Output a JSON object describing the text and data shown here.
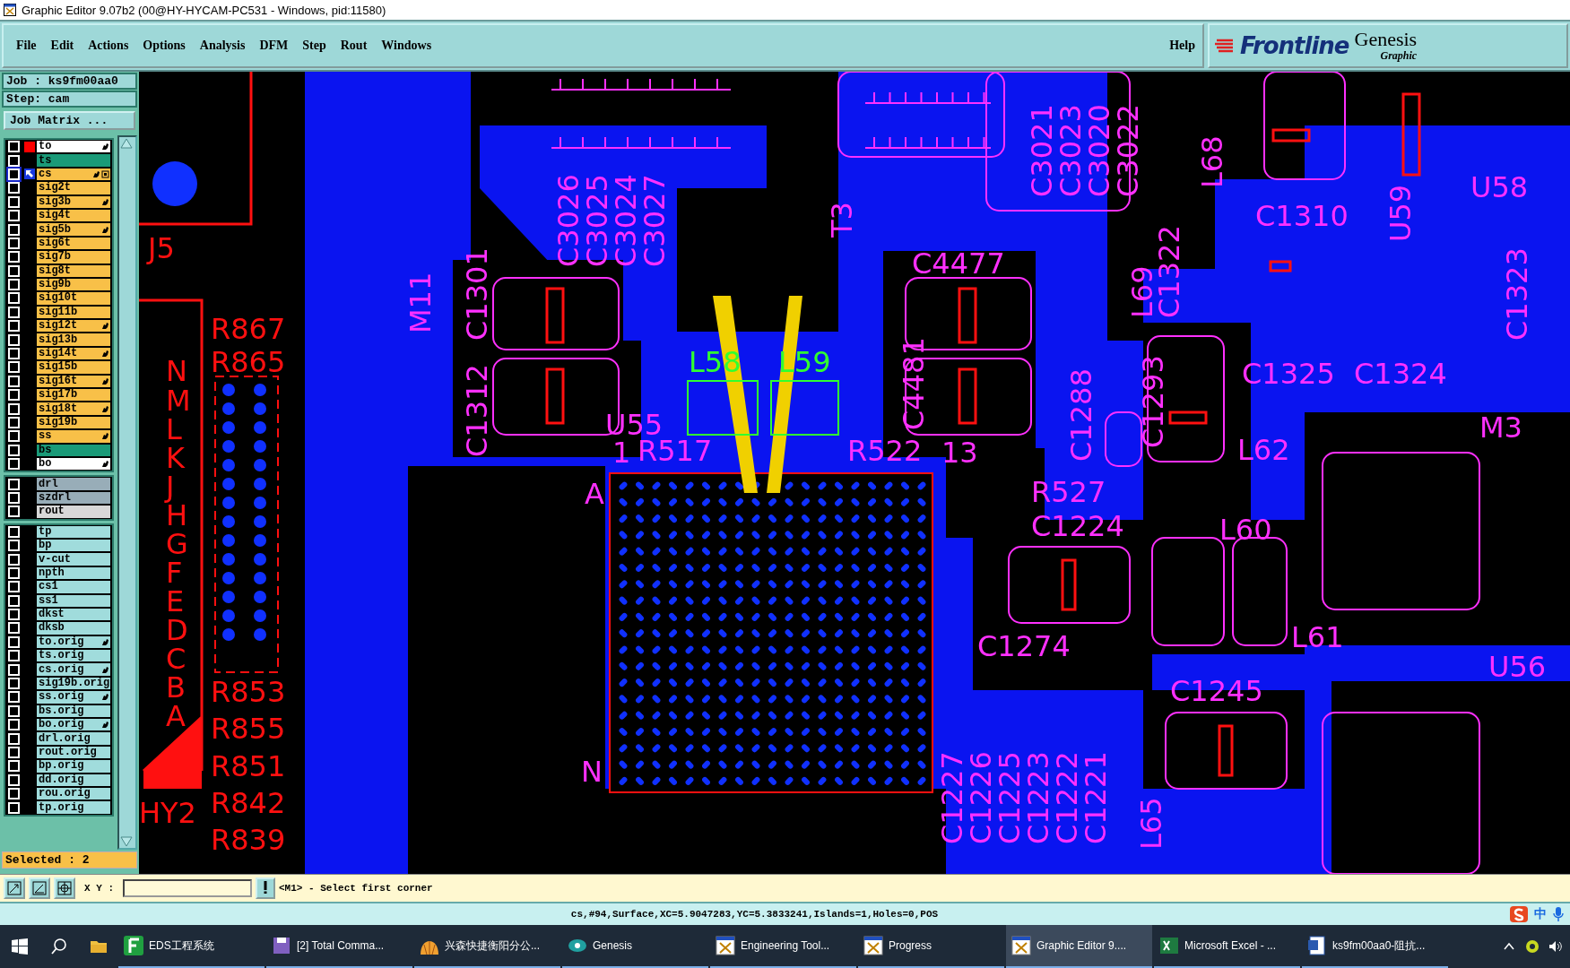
{
  "window": {
    "title": "Graphic Editor 9.07b2 (00@HY-HYCAM-PC531 - Windows, pid:11580)"
  },
  "menu": [
    "File",
    "Edit",
    "Actions",
    "Options",
    "Analysis",
    "DFM",
    "Step",
    "Rout",
    "Windows"
  ],
  "help_menu": "Help",
  "logo": {
    "brand": "Frontline",
    "product": "Genesis",
    "subtitle": "Graphic"
  },
  "panel": {
    "job": "Job : ks9fm00aa0",
    "step": "Step: cam",
    "job_matrix_button": "Job Matrix ...",
    "selected": "Selected : 2",
    "layer_groups": [
      {
        "layers": [
          {
            "name": "to",
            "color": "#ffffff",
            "shown": true,
            "work": false,
            "affected": true,
            "grid_mark": false
          },
          {
            "name": "ts",
            "color": "#1a9a78",
            "shown": false,
            "work": false,
            "affected": false,
            "grid_mark": false
          },
          {
            "name": "cs",
            "color": "#f8c048",
            "shown": false,
            "work": true,
            "affected": true,
            "grid_mark": true
          },
          {
            "name": "sig2t",
            "color": "#f8c048",
            "shown": false,
            "work": false,
            "affected": false,
            "grid_mark": false
          },
          {
            "name": "sig3b",
            "color": "#f8c048",
            "shown": false,
            "work": false,
            "affected": true,
            "grid_mark": false
          },
          {
            "name": "sig4t",
            "color": "#f8c048",
            "shown": false,
            "work": false,
            "affected": false,
            "grid_mark": false
          },
          {
            "name": "sig5b",
            "color": "#f8c048",
            "shown": false,
            "work": false,
            "affected": true,
            "grid_mark": false
          },
          {
            "name": "sig6t",
            "color": "#f8c048",
            "shown": false,
            "work": false,
            "affected": false,
            "grid_mark": false
          },
          {
            "name": "sig7b",
            "color": "#f8c048",
            "shown": false,
            "work": false,
            "affected": false,
            "grid_mark": false
          },
          {
            "name": "sig8t",
            "color": "#f8c048",
            "shown": false,
            "work": false,
            "affected": false,
            "grid_mark": false
          },
          {
            "name": "sig9b",
            "color": "#f8c048",
            "shown": false,
            "work": false,
            "affected": false,
            "grid_mark": false
          },
          {
            "name": "sig10t",
            "color": "#f8c048",
            "shown": false,
            "work": false,
            "affected": false,
            "grid_mark": false
          },
          {
            "name": "sig11b",
            "color": "#f8c048",
            "shown": false,
            "work": false,
            "affected": false,
            "grid_mark": false
          },
          {
            "name": "sig12t",
            "color": "#f8c048",
            "shown": false,
            "work": false,
            "affected": true,
            "grid_mark": false
          },
          {
            "name": "sig13b",
            "color": "#f8c048",
            "shown": false,
            "work": false,
            "affected": false,
            "grid_mark": false
          },
          {
            "name": "sig14t",
            "color": "#f8c048",
            "shown": false,
            "work": false,
            "affected": true,
            "grid_mark": false
          },
          {
            "name": "sig15b",
            "color": "#f8c048",
            "shown": false,
            "work": false,
            "affected": false,
            "grid_mark": false
          },
          {
            "name": "sig16t",
            "color": "#f8c048",
            "shown": false,
            "work": false,
            "affected": true,
            "grid_mark": false
          },
          {
            "name": "sig17b",
            "color": "#f8c048",
            "shown": false,
            "work": false,
            "affected": false,
            "grid_mark": false
          },
          {
            "name": "sig18t",
            "color": "#f8c048",
            "shown": false,
            "work": false,
            "affected": true,
            "grid_mark": false
          },
          {
            "name": "sig19b",
            "color": "#f8c048",
            "shown": false,
            "work": false,
            "affected": false,
            "grid_mark": false
          },
          {
            "name": "ss",
            "color": "#f8c048",
            "shown": false,
            "work": false,
            "affected": true,
            "grid_mark": false
          },
          {
            "name": "bs",
            "color": "#1a9a78",
            "shown": false,
            "work": false,
            "affected": false,
            "grid_mark": false
          },
          {
            "name": "bo",
            "color": "#ffffff",
            "shown": false,
            "work": false,
            "affected": true,
            "grid_mark": false
          }
        ]
      },
      {
        "layers": [
          {
            "name": "drl",
            "color": "#98adb8",
            "shown": false,
            "work": false,
            "affected": false,
            "grid_mark": false
          },
          {
            "name": "szdrl",
            "color": "#98adb8",
            "shown": false,
            "work": false,
            "affected": false,
            "grid_mark": false
          },
          {
            "name": "rout",
            "color": "#d8d8d8",
            "shown": false,
            "work": false,
            "affected": false,
            "grid_mark": false
          }
        ]
      },
      {
        "layers": [
          {
            "name": "tp",
            "color": "#a0dcdc",
            "shown": false,
            "work": false,
            "affected": false,
            "grid_mark": false
          },
          {
            "name": "bp",
            "color": "#a0dcdc",
            "shown": false,
            "work": false,
            "affected": false,
            "grid_mark": false
          },
          {
            "name": "v-cut",
            "color": "#a0dcdc",
            "shown": false,
            "work": false,
            "affected": false,
            "grid_mark": false
          },
          {
            "name": "npth",
            "color": "#a0dcdc",
            "shown": false,
            "work": false,
            "affected": false,
            "grid_mark": false
          },
          {
            "name": "cs1",
            "color": "#a0dcdc",
            "shown": false,
            "work": false,
            "affected": false,
            "grid_mark": false
          },
          {
            "name": "ss1",
            "color": "#a0dcdc",
            "shown": false,
            "work": false,
            "affected": false,
            "grid_mark": false
          },
          {
            "name": "dkst",
            "color": "#a0dcdc",
            "shown": false,
            "work": false,
            "affected": false,
            "grid_mark": false
          },
          {
            "name": "dksb",
            "color": "#a0dcdc",
            "shown": false,
            "work": false,
            "affected": false,
            "grid_mark": false
          },
          {
            "name": "to.orig",
            "color": "#a0dcdc",
            "shown": false,
            "work": false,
            "affected": true,
            "grid_mark": false
          },
          {
            "name": "ts.orig",
            "color": "#a0dcdc",
            "shown": false,
            "work": false,
            "affected": false,
            "grid_mark": false
          },
          {
            "name": "cs.orig",
            "color": "#a0dcdc",
            "shown": false,
            "work": false,
            "affected": true,
            "grid_mark": false
          },
          {
            "name": "sig19b.orig",
            "color": "#a0dcdc",
            "shown": false,
            "work": false,
            "affected": false,
            "grid_mark": false
          },
          {
            "name": "ss.orig",
            "color": "#a0dcdc",
            "shown": false,
            "work": false,
            "affected": true,
            "grid_mark": false
          },
          {
            "name": "bs.orig",
            "color": "#a0dcdc",
            "shown": false,
            "work": false,
            "affected": false,
            "grid_mark": false
          },
          {
            "name": "bo.orig",
            "color": "#a0dcdc",
            "shown": false,
            "work": false,
            "affected": true,
            "grid_mark": false
          },
          {
            "name": "drl.orig",
            "color": "#a0dcdc",
            "shown": false,
            "work": false,
            "affected": false,
            "grid_mark": false
          },
          {
            "name": "rout.orig",
            "color": "#a0dcdc",
            "shown": false,
            "work": false,
            "affected": false,
            "grid_mark": false
          },
          {
            "name": "bp.orig",
            "color": "#a0dcdc",
            "shown": false,
            "work": false,
            "affected": false,
            "grid_mark": false
          },
          {
            "name": "dd.orig",
            "color": "#a0dcdc",
            "shown": false,
            "work": false,
            "affected": false,
            "grid_mark": false
          },
          {
            "name": "rou.orig",
            "color": "#a0dcdc",
            "shown": false,
            "work": false,
            "affected": false,
            "grid_mark": false
          },
          {
            "name": "tp.orig",
            "color": "#a0dcdc",
            "shown": false,
            "work": false,
            "affected": false,
            "grid_mark": false
          }
        ]
      }
    ]
  },
  "canvas": {
    "labels": [
      {
        "text": "J5",
        "color": "#ff1010"
      },
      {
        "text": "R867",
        "color": "#ff1010"
      },
      {
        "text": "R865",
        "color": "#ff1010"
      },
      {
        "text": "N",
        "color": "#ff1010"
      },
      {
        "text": "M",
        "color": "#ff1010"
      },
      {
        "text": "L",
        "color": "#ff1010"
      },
      {
        "text": "K",
        "color": "#ff1010"
      },
      {
        "text": "J",
        "color": "#ff1010"
      },
      {
        "text": "H",
        "color": "#ff1010"
      },
      {
        "text": "G",
        "color": "#ff1010"
      },
      {
        "text": "F",
        "color": "#ff1010"
      },
      {
        "text": "E",
        "color": "#ff1010"
      },
      {
        "text": "D",
        "color": "#ff1010"
      },
      {
        "text": "C",
        "color": "#ff1010"
      },
      {
        "text": "B",
        "color": "#ff1010"
      },
      {
        "text": "A",
        "color": "#ff1010"
      },
      {
        "text": "R853",
        "color": "#ff1010"
      },
      {
        "text": "R855",
        "color": "#ff1010"
      },
      {
        "text": "R851",
        "color": "#ff1010"
      },
      {
        "text": "R842",
        "color": "#ff1010"
      },
      {
        "text": "R839",
        "color": "#ff1010"
      },
      {
        "text": "HY2",
        "color": "#ff1010"
      },
      {
        "text": "C3026",
        "color": "#ff30ff"
      },
      {
        "text": "C3025",
        "color": "#ff30ff"
      },
      {
        "text": "C3024",
        "color": "#ff30ff"
      },
      {
        "text": "C3027",
        "color": "#ff30ff"
      },
      {
        "text": "C3021",
        "color": "#ff30ff"
      },
      {
        "text": "C3023",
        "color": "#ff30ff"
      },
      {
        "text": "C3020",
        "color": "#ff30ff"
      },
      {
        "text": "C3022",
        "color": "#ff30ff"
      },
      {
        "text": "T3",
        "color": "#ff30ff"
      },
      {
        "text": "M11",
        "color": "#ff30ff"
      },
      {
        "text": "C1301",
        "color": "#ff30ff"
      },
      {
        "text": "C1312",
        "color": "#ff30ff"
      },
      {
        "text": "L58",
        "color": "#30ff30"
      },
      {
        "text": "L59",
        "color": "#30ff30"
      },
      {
        "text": "U55",
        "color": "#ff30ff"
      },
      {
        "text": "1",
        "color": "#ff30ff"
      },
      {
        "text": "R517",
        "color": "#ff30ff"
      },
      {
        "text": "R522",
        "color": "#ff30ff"
      },
      {
        "text": "C4477",
        "color": "#ff30ff"
      },
      {
        "text": "C4481",
        "color": "#ff30ff"
      },
      {
        "text": "13",
        "color": "#ff30ff"
      },
      {
        "text": "C1288",
        "color": "#ff30ff"
      },
      {
        "text": "C1293",
        "color": "#ff30ff"
      },
      {
        "text": "L69",
        "color": "#ff30ff"
      },
      {
        "text": "C1322",
        "color": "#ff30ff"
      },
      {
        "text": "L68",
        "color": "#ff30ff"
      },
      {
        "text": "C1310",
        "color": "#ff30ff"
      },
      {
        "text": "U59",
        "color": "#ff30ff"
      },
      {
        "text": "U58",
        "color": "#ff30ff"
      },
      {
        "text": "C1323",
        "color": "#ff30ff"
      },
      {
        "text": "C1325",
        "color": "#ff30ff"
      },
      {
        "text": "C1324",
        "color": "#ff30ff"
      },
      {
        "text": "M3",
        "color": "#ff30ff"
      },
      {
        "text": "L62",
        "color": "#ff30ff"
      },
      {
        "text": "R527",
        "color": "#ff30ff"
      },
      {
        "text": "C1224",
        "color": "#ff30ff"
      },
      {
        "text": "L60",
        "color": "#ff30ff"
      },
      {
        "text": "C1274",
        "color": "#ff30ff"
      },
      {
        "text": "L61",
        "color": "#ff30ff"
      },
      {
        "text": "U56",
        "color": "#ff30ff"
      },
      {
        "text": "C1245",
        "color": "#ff30ff"
      },
      {
        "text": "C1227",
        "color": "#ff30ff"
      },
      {
        "text": "C1226",
        "color": "#ff30ff"
      },
      {
        "text": "C1225",
        "color": "#ff30ff"
      },
      {
        "text": "C1223",
        "color": "#ff30ff"
      },
      {
        "text": "C1222",
        "color": "#ff30ff"
      },
      {
        "text": "C1221",
        "color": "#ff30ff"
      },
      {
        "text": "L65",
        "color": "#ff30ff"
      },
      {
        "text": "A",
        "color": "#ff30ff"
      },
      {
        "text": "N",
        "color": "#ff30ff"
      }
    ]
  },
  "command_bar": {
    "coordinate_label": "X Y :",
    "prompt": "<M1> - Select first corner"
  },
  "status_bar": "cs,#94,Surface,XC=5.9047283,YC=5.3833241,Islands=1,Holes=0,POS",
  "taskbar": {
    "apps": [
      {
        "label": "EDS工程系统",
        "kind": "eds",
        "selected": false
      },
      {
        "label": "[2] Total Comma...",
        "kind": "disk",
        "selected": false
      },
      {
        "label": "兴森快捷衡阳分公...",
        "kind": "shell",
        "selected": false
      },
      {
        "label": "Genesis",
        "kind": "genesis",
        "selected": false
      },
      {
        "label": "Engineering Tool...",
        "kind": "editor",
        "selected": false
      },
      {
        "label": "Progress",
        "kind": "editor",
        "selected": false
      },
      {
        "label": "Graphic Editor 9....",
        "kind": "editor",
        "selected": true
      },
      {
        "label": "Microsoft Excel - ...",
        "kind": "excel",
        "selected": false
      },
      {
        "label": "ks9fm00aa0-阻抗...",
        "kind": "document",
        "selected": false
      }
    ],
    "ime": "中"
  }
}
